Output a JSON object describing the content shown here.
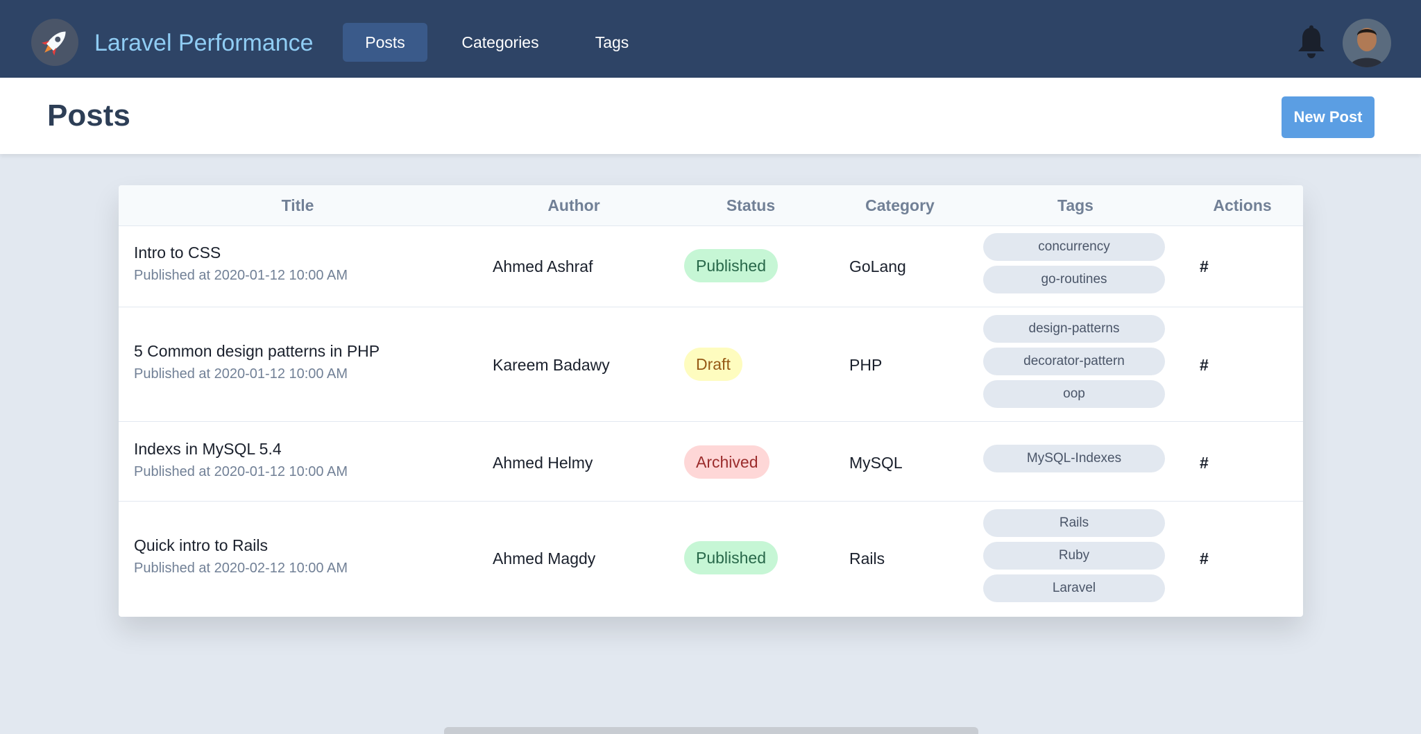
{
  "brand": {
    "name": "Laravel Performance",
    "logo_icon": "rocket-icon"
  },
  "nav": {
    "items": [
      {
        "label": "Posts",
        "active": true
      },
      {
        "label": "Categories",
        "active": false
      },
      {
        "label": "Tags",
        "active": false
      }
    ]
  },
  "header": {
    "title": "Posts",
    "new_post_label": "New Post"
  },
  "table": {
    "columns": [
      "Title",
      "Author",
      "Status",
      "Category",
      "Tags",
      "Actions"
    ],
    "rows": [
      {
        "title": "Intro to CSS",
        "date": "Published at 2020-01-12 10:00 AM",
        "author": "Ahmed Ashraf",
        "status": "Published",
        "category": "GoLang",
        "tags": [
          "concurrency",
          "go-routines"
        ],
        "action": "#"
      },
      {
        "title": "5 Common design patterns in PHP",
        "date": "Published at 2020-01-12 10:00 AM",
        "author": "Kareem Badawy",
        "status": "Draft",
        "category": "PHP",
        "tags": [
          "design-patterns",
          "decorator-pattern",
          "oop"
        ],
        "action": "#"
      },
      {
        "title": "Indexs in MySQL 5.4",
        "date": "Published at 2020-01-12 10:00 AM",
        "author": "Ahmed Helmy",
        "status": "Archived",
        "category": "MySQL",
        "tags": [
          "MySQL-Indexes"
        ],
        "action": "#"
      },
      {
        "title": "Quick intro to Rails",
        "date": "Published at 2020-02-12 10:00 AM",
        "author": "Ahmed Magdy",
        "status": "Published",
        "category": "Rails",
        "tags": [
          "Rails",
          "Ruby",
          "Laravel"
        ],
        "action": "#"
      }
    ]
  },
  "colors": {
    "navbar": "#2e4466",
    "brand_text": "#90cdf4",
    "accent_button": "#5b9ee3",
    "published_bg": "#c6f6d5",
    "draft_bg": "#fefcbf",
    "archived_bg": "#fed7d7"
  }
}
